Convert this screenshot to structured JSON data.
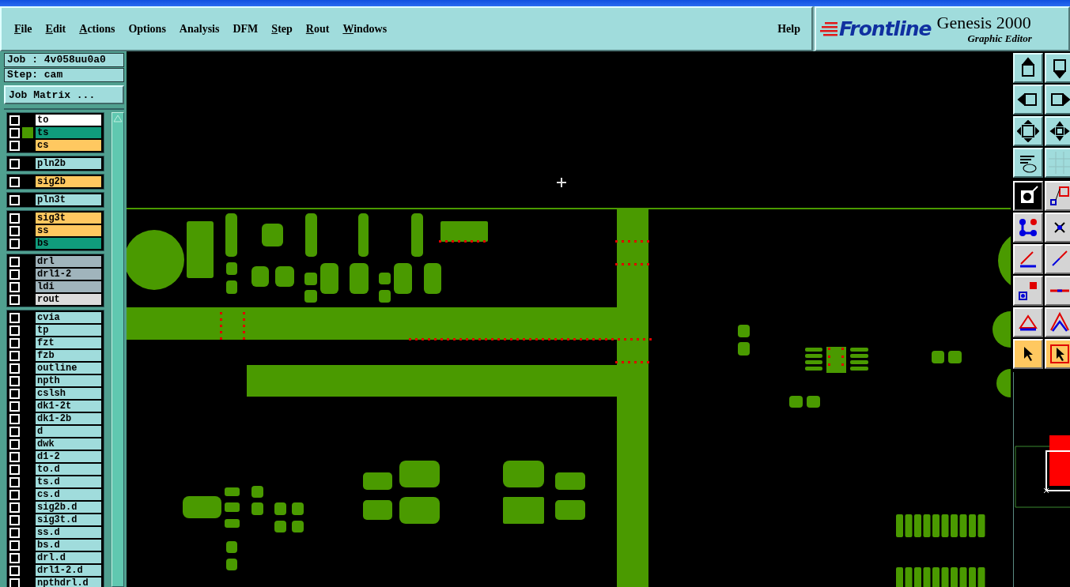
{
  "menu": [
    {
      "label": "File",
      "underlined": true
    },
    {
      "label": "Edit",
      "underlined": true
    },
    {
      "label": "Actions",
      "underlined": true
    },
    {
      "label": "Options",
      "underlined": false
    },
    {
      "label": "Analysis",
      "underlined": false
    },
    {
      "label": "DFM",
      "underlined": false
    },
    {
      "label": "Step",
      "underlined": true
    },
    {
      "label": "Rout",
      "underlined": true
    },
    {
      "label": "Windows",
      "underlined": true
    }
  ],
  "help": {
    "label": "Help",
    "underlined": false
  },
  "logo": {
    "brand": "Frontline",
    "product": "Genesis 2000",
    "subtitle": "Graphic Editor"
  },
  "job": {
    "job_label": "Job : 4v058uu0a0",
    "step_label": "Step: cam",
    "matrix_button": "Job Matrix ..."
  },
  "layer_groups": [
    {
      "layers": [
        {
          "name": "to",
          "color": "#ffffff",
          "checked": false,
          "work": false
        },
        {
          "name": "ts",
          "color": "#109c7c",
          "checked": false,
          "work": true
        },
        {
          "name": "cs",
          "color": "#ffc860",
          "checked": false,
          "work": false
        }
      ]
    },
    {
      "layers": [
        {
          "name": "pln2b",
          "color": "#a0dcdc",
          "checked": false,
          "work": false
        }
      ]
    },
    {
      "layers": [
        {
          "name": "sig2b",
          "color": "#ffc860",
          "checked": false,
          "work": false
        }
      ]
    },
    {
      "layers": [
        {
          "name": "pln3t",
          "color": "#a0dcdc",
          "checked": false,
          "work": false
        }
      ]
    },
    {
      "layers": [
        {
          "name": "sig3t",
          "color": "#ffc860",
          "checked": false,
          "work": false
        },
        {
          "name": "ss",
          "color": "#ffc860",
          "checked": false,
          "work": false
        },
        {
          "name": "bs",
          "color": "#109c7c",
          "checked": false,
          "work": false
        }
      ]
    },
    {
      "layers": [
        {
          "name": "drl",
          "color": "#a0b4bc",
          "checked": false,
          "work": false
        },
        {
          "name": "drl1-2",
          "color": "#a0b4bc",
          "checked": false,
          "work": false
        },
        {
          "name": "ldi",
          "color": "#a0b4bc",
          "checked": false,
          "work": false
        },
        {
          "name": "rout",
          "color": "#dcdcdc",
          "checked": false,
          "work": false
        }
      ]
    },
    {
      "layers": [
        {
          "name": "cvia",
          "color": "#a0dcdc",
          "checked": false,
          "work": false
        },
        {
          "name": "tp",
          "color": "#a0dcdc",
          "checked": false,
          "work": false
        },
        {
          "name": "fzt",
          "color": "#a0dcdc",
          "checked": false,
          "work": false
        },
        {
          "name": "fzb",
          "color": "#a0dcdc",
          "checked": false,
          "work": false
        },
        {
          "name": "outline",
          "color": "#a0dcdc",
          "checked": false,
          "work": false
        },
        {
          "name": "npth",
          "color": "#a0dcdc",
          "checked": false,
          "work": false
        },
        {
          "name": "cslsh",
          "color": "#a0dcdc",
          "checked": false,
          "work": false
        },
        {
          "name": "dk1-2t",
          "color": "#a0dcdc",
          "checked": false,
          "work": false
        },
        {
          "name": "dk1-2b",
          "color": "#a0dcdc",
          "checked": false,
          "work": false
        },
        {
          "name": "d",
          "color": "#a0dcdc",
          "checked": false,
          "work": false
        },
        {
          "name": "dwk",
          "color": "#a0dcdc",
          "checked": false,
          "work": false
        },
        {
          "name": "d1-2",
          "color": "#a0dcdc",
          "checked": false,
          "work": false
        },
        {
          "name": "to.d",
          "color": "#a0dcdc",
          "checked": false,
          "work": false
        },
        {
          "name": "ts.d",
          "color": "#a0dcdc",
          "checked": false,
          "work": false
        },
        {
          "name": "cs.d",
          "color": "#a0dcdc",
          "checked": false,
          "work": false
        },
        {
          "name": "sig2b.d",
          "color": "#a0dcdc",
          "checked": false,
          "work": false
        },
        {
          "name": "sig3t.d",
          "color": "#a0dcdc",
          "checked": false,
          "work": false
        },
        {
          "name": "ss.d",
          "color": "#a0dcdc",
          "checked": false,
          "work": false
        },
        {
          "name": "bs.d",
          "color": "#a0dcdc",
          "checked": false,
          "work": false
        },
        {
          "name": "drl.d",
          "color": "#a0dcdc",
          "checked": false,
          "work": false
        },
        {
          "name": "drl1-2.d",
          "color": "#a0dcdc",
          "checked": false,
          "work": false
        },
        {
          "name": "npthdrl.d",
          "color": "#a0dcdc",
          "checked": false,
          "work": false
        }
      ]
    }
  ],
  "tool_groups": [
    {
      "tools": [
        {
          "kind": "up"
        },
        {
          "kind": "down"
        },
        {
          "kind": "left"
        },
        {
          "kind": "right"
        },
        {
          "kind": "fit"
        },
        {
          "kind": "center"
        },
        {
          "kind": "tools"
        },
        {
          "kind": "grid"
        }
      ]
    },
    {
      "tools": [
        {
          "kind": "snap",
          "selected": false
        },
        {
          "kind": "corner",
          "selected": false
        },
        {
          "kind": "net",
          "selected": false
        },
        {
          "kind": "cross",
          "selected": false
        },
        {
          "kind": "angle",
          "selected": false
        },
        {
          "kind": "diagonal",
          "selected": false
        },
        {
          "kind": "pads",
          "selected": false
        },
        {
          "kind": "segment",
          "selected": false
        },
        {
          "kind": "triangle",
          "selected": false
        },
        {
          "kind": "peak",
          "selected": false
        },
        {
          "kind": "pointer",
          "selected": true
        },
        {
          "kind": "pointer-box",
          "selected": true
        }
      ]
    }
  ]
}
